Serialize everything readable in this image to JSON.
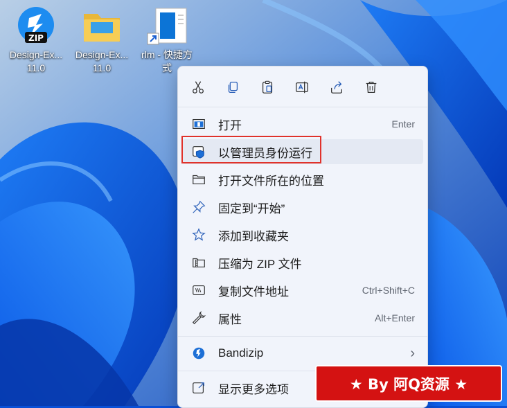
{
  "desktop": {
    "icons": [
      {
        "label": "Design-Ex...\n11.0",
        "icon": "zip-icon"
      },
      {
        "label": "Design-Ex...\n11.0",
        "icon": "folder-icon"
      },
      {
        "label": "rlm - 快捷方\n式",
        "icon": "shortcut-icon"
      }
    ],
    "zip_badge": "ZIP"
  },
  "context_menu": {
    "toolbar": [
      {
        "name": "cut",
        "icon": "scissors-icon"
      },
      {
        "name": "copy",
        "icon": "copy-icon"
      },
      {
        "name": "paste",
        "icon": "paste-icon"
      },
      {
        "name": "rename",
        "icon": "rename-icon"
      },
      {
        "name": "share",
        "icon": "share-icon"
      },
      {
        "name": "delete",
        "icon": "trash-icon"
      }
    ],
    "items": [
      {
        "label": "打开",
        "shortcut": "Enter",
        "icon": "open-window-icon"
      },
      {
        "label": "以管理员身份运行",
        "shortcut": "",
        "icon": "admin-shield-icon"
      },
      {
        "label": "打开文件所在的位置",
        "shortcut": "",
        "icon": "folder-outline-icon"
      },
      {
        "label": "固定到“开始”",
        "shortcut": "",
        "icon": "pin-icon"
      },
      {
        "label": "添加到收藏夹",
        "shortcut": "",
        "icon": "star-icon"
      },
      {
        "label": "压缩为 ZIP 文件",
        "shortcut": "",
        "icon": "zip-folder-icon"
      },
      {
        "label": "复制文件地址",
        "shortcut": "Ctrl+Shift+C",
        "icon": "copy-path-icon"
      },
      {
        "label": "属性",
        "shortcut": "Alt+Enter",
        "icon": "wrench-icon"
      },
      {
        "label": "Bandizip",
        "shortcut": "",
        "icon": "bandizip-icon"
      },
      {
        "label": "显示更多选项",
        "shortcut": "",
        "icon": "more-options-icon"
      }
    ],
    "submenu_arrow": "›"
  },
  "watermark": {
    "text": "★ By 阿Q资源 ★"
  },
  "colors": {
    "wallpaper_blue": "#0a4fd6",
    "menu_bg": "#f1f4fb",
    "highlight_red": "#e0322b",
    "watermark_red": "#d41212"
  }
}
